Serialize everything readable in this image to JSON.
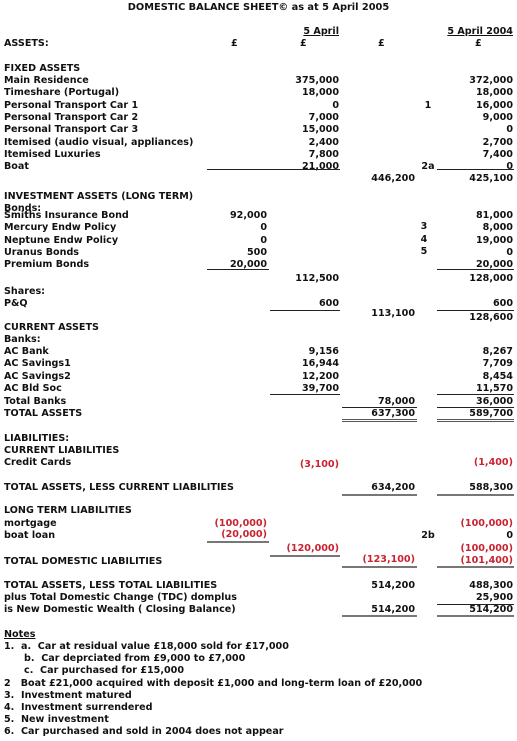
{
  "title": "DOMESTIC BALANCE SHEET© as at 5 April 2005",
  "header": {
    "assets_label": "ASSETS:",
    "col_2005_label": "5 April",
    "col_2004_label": "5 April 2004",
    "currency": "£"
  },
  "fixed_assets": {
    "heading": "FIXED ASSETS",
    "rows": [
      {
        "label": "Main Residence",
        "y2005": "375,000",
        "ref": "",
        "y2004": "372,000"
      },
      {
        "label": "Timeshare (Portugal)",
        "y2005": "18,000",
        "ref": "",
        "y2004": "18,000"
      },
      {
        "label": "Personal Transport Car 1",
        "y2005": "0",
        "ref": "1",
        "y2004": "16,000"
      },
      {
        "label": "Personal Transport Car 2",
        "y2005": "7,000",
        "ref": "",
        "y2004": "9,000"
      },
      {
        "label": "Personal Transport Car 3",
        "y2005": "15,000",
        "ref": "",
        "y2004": "0"
      },
      {
        "label": "Itemised (audio visual, appliances)",
        "y2005": "2,400",
        "ref": "",
        "y2004": "2,700"
      },
      {
        "label": "Itemised Luxuries",
        "y2005": "7,800",
        "ref": "",
        "y2004": "7,400"
      },
      {
        "label": "Boat",
        "y2005": "21,000",
        "ref": "2a",
        "y2004": "0"
      }
    ],
    "total_2005": "446,200",
    "total_2004": "425,100"
  },
  "investment_assets": {
    "heading": "INVESTMENT ASSETS (LONG TERM)",
    "bonds_label": "Bonds:",
    "bonds": [
      {
        "label": "Smiths Insurance Bond",
        "y2005": "92,000",
        "ref": "",
        "y2004": "81,000"
      },
      {
        "label": "Mercury Endw Policy",
        "y2005": "0",
        "ref": "3",
        "y2004": "8,000"
      },
      {
        "label": "Neptune Endw Policy",
        "y2005": "0",
        "ref": "4",
        "y2004": "19,000"
      },
      {
        "label": "Uranus Bonds",
        "y2005": "500",
        "ref": "5",
        "y2004": "0"
      },
      {
        "label": "Premium Bonds",
        "y2005": "20,000",
        "ref": "",
        "y2004": "20,000"
      }
    ],
    "bonds_total_2005": "112,500",
    "bonds_total_2004": "128,000",
    "shares_label": "Shares:",
    "shares": [
      {
        "label": "P&Q",
        "y2005": "600",
        "y2004": "600"
      }
    ],
    "total_2005": "113,100",
    "total_2004": "128,600"
  },
  "current_assets": {
    "heading": "CURRENT ASSETS",
    "banks_label": "Banks:",
    "banks": [
      {
        "label": "AC Bank",
        "y2005": "9,156",
        "y2004": "8,267"
      },
      {
        "label": "AC Savings1",
        "y2005": "16,944",
        "y2004": "7,709"
      },
      {
        "label": "AC Savings2",
        "y2005": "12,200",
        "y2004": "8,454"
      },
      {
        "label": "AC Bld Soc",
        "y2005": "39,700",
        "y2004": "11,570"
      }
    ],
    "total_banks_label": "Total Banks",
    "total_banks_2005": "78,000",
    "total_banks_2004": "36,000",
    "total_assets_label": "TOTAL ASSETS",
    "total_assets_2005": "637,300",
    "total_assets_2004": "589,700"
  },
  "liabilities": {
    "heading": "LIABILITIES:",
    "current_heading": "CURRENT LIABILITIES",
    "credit_cards_label": "Credit Cards",
    "credit_cards_2005": "(3,100)",
    "credit_cards_2004": "(1,400)",
    "assets_less_current_label": "TOTAL ASSETS, LESS CURRENT LIABILITIES",
    "assets_less_current_2005": "634,200",
    "assets_less_current_2004": "588,300",
    "long_term_heading": "LONG TERM LIABILITIES",
    "mortgage_label": "mortgage",
    "mortgage_2005": "(100,000)",
    "mortgage_2004": "(100,000)",
    "boat_loan_label": "boat loan",
    "boat_loan_2005": "(20,000)",
    "boat_loan_ref": "2b",
    "boat_loan_2004": "0",
    "long_term_total_2005": "(120,000)",
    "long_term_total_2004": "(100,000)",
    "total_domestic_label": "TOTAL DOMESTIC LIABILITIES",
    "total_domestic_2005": "(123,100)",
    "total_domestic_2004": "(101,400)"
  },
  "summary": {
    "assets_less_total_label": "TOTAL ASSETS, LESS TOTAL LIABILITIES",
    "assets_less_total_2005": "514,200",
    "assets_less_total_2004": "488,300",
    "tdc_label": "plus Total Domestic Change (TDC) domplus",
    "tdc_2004": "25,900",
    "new_wealth_label": "is New Domestic Wealth ( Closing Balance)",
    "new_wealth_2005": "514,200",
    "new_wealth_2004": "514,200"
  },
  "notes": {
    "heading": "Notes",
    "items": [
      "1.  a.  Car at residual value £18,000 sold for £17,000",
      "      b.  Car deprciated from £9,000 to £7,000",
      "      c.  Car purchased for £15,000",
      "2   Boat £21,000 acquired with deposit £1,000 and long-term loan of £20,000",
      "3.  Investment matured",
      "4.  Investment surrendered",
      "5.  New investment",
      "6.  Car purchased and sold in 2004 does not appear"
    ]
  },
  "colors": {
    "text": "#111111",
    "negative": "#c8232f"
  }
}
